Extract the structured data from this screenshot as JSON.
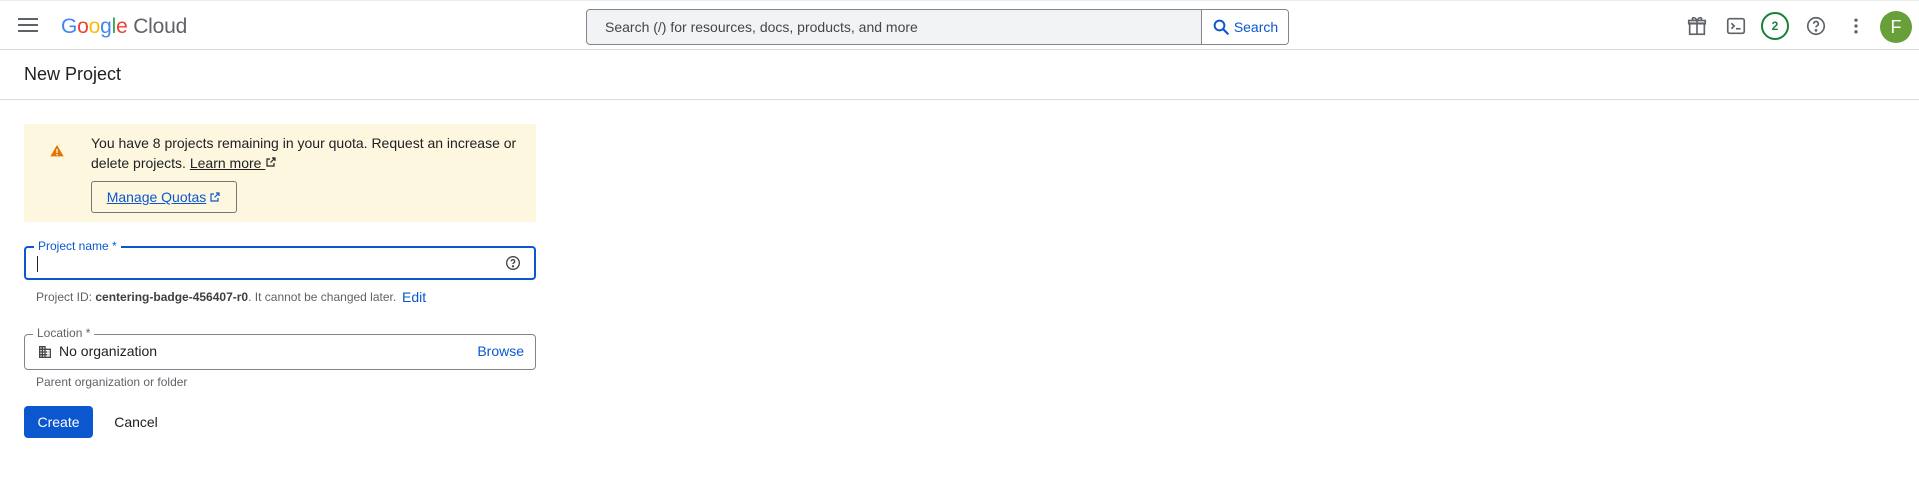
{
  "topbar": {
    "logo_letters": [
      "G",
      "o",
      "o",
      "g",
      "l",
      "e"
    ],
    "logo_cloud": "Cloud",
    "search_placeholder": "Search (/) for resources, docs, products, and more",
    "search_button_label": "Search",
    "notification_count": "2",
    "avatar_initial": "F",
    "icons": [
      "menu-icon",
      "search-icon",
      "gift-icon",
      "terminal-icon",
      "help-icon",
      "more-vert-icon"
    ]
  },
  "page": {
    "title": "New Project"
  },
  "alert": {
    "text": "You have 8 projects remaining in your quota. Request an increase or delete projects.",
    "learn_more": "Learn more",
    "manage_quotas": "Manage Quotas",
    "icon": "warning-icon"
  },
  "form": {
    "project_name_label": "Project name *",
    "project_name_value": "",
    "project_id_prefix": "Project ID:",
    "project_id": "centering-badge-456407-r0",
    "project_id_suffix": ". It cannot be changed later.",
    "edit_label": "Edit",
    "location_label": "Location *",
    "location_value": "No organization",
    "browse_label": "Browse",
    "location_hint": "Parent organization or folder"
  },
  "actions": {
    "create": "Create",
    "cancel": "Cancel"
  },
  "colors": {
    "primary": "#0b57d0",
    "warning_bg": "#fef7e0",
    "warning_icon": "#e37400",
    "badge_green": "#188038",
    "avatar_bg": "#689f38"
  }
}
